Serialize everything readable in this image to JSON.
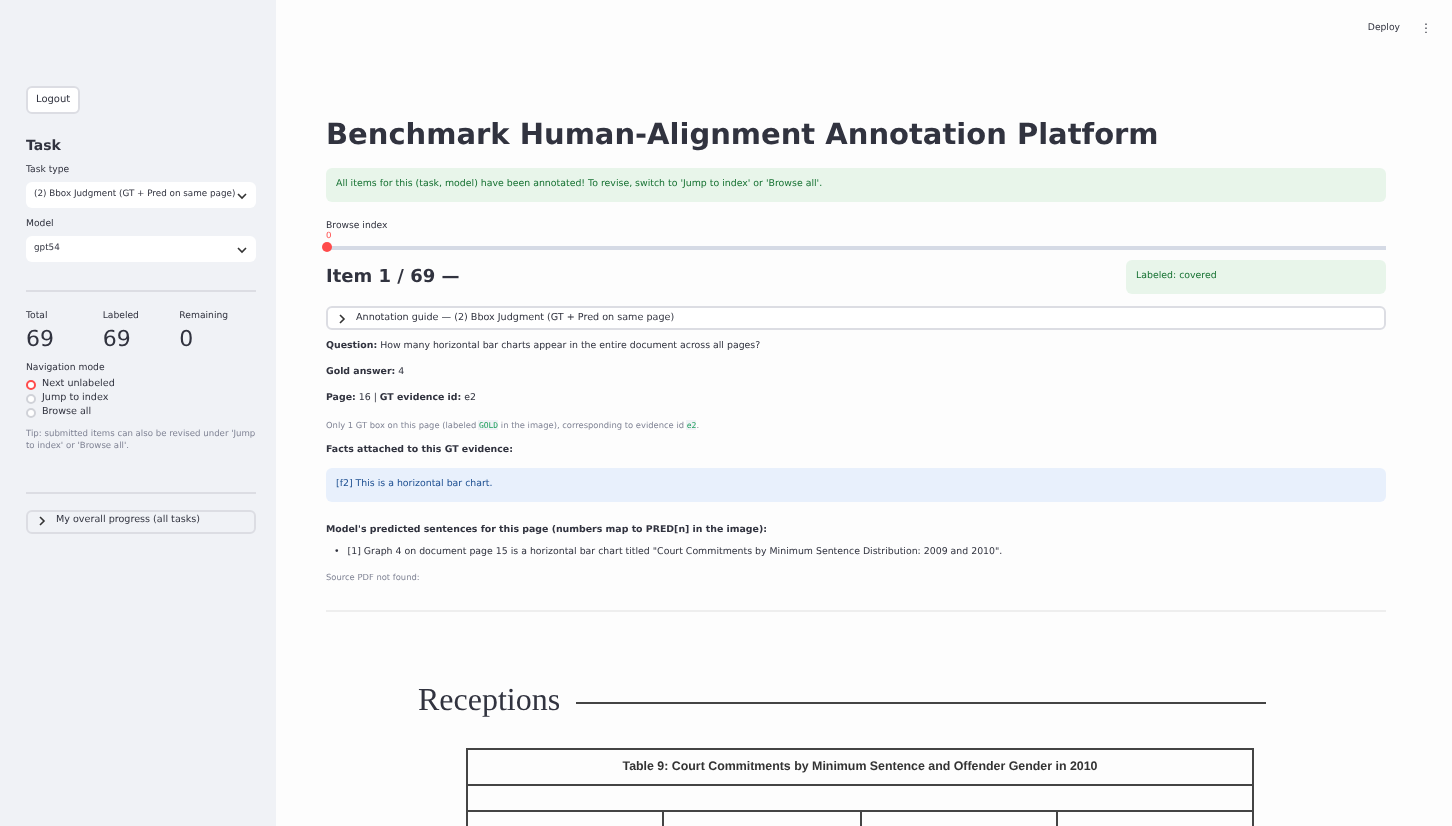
{
  "sidebar": {
    "logout_button": "Logout",
    "section_title": "Task",
    "task_type": {
      "label": "Task type",
      "value": "(2) Bbox Judgment (GT + Pred on same page)"
    },
    "model": {
      "label": "Model",
      "value": "gpt54"
    },
    "metrics": [
      {
        "label": "Total",
        "value": "69"
      },
      {
        "label": "Labeled",
        "value": "69"
      },
      {
        "label": "Remaining",
        "value": "0"
      }
    ],
    "navigation_mode": {
      "label": "Navigation mode",
      "options": [
        {
          "label": "Next unlabeled",
          "selected": true
        },
        {
          "label": "Jump to index",
          "selected": false
        },
        {
          "label": "Browse all",
          "selected": false
        }
      ]
    },
    "tip": "Tip: submitted items can also be revised under 'Jump to index' or 'Browse all'.",
    "progress_expander": {
      "label": "My overall progress (all tasks)",
      "expanded": false
    }
  },
  "toolbar": {
    "deploy": "Deploy",
    "menu": "⋮"
  },
  "main": {
    "title": "Benchmark Human-Alignment Annotation Platform",
    "success_alert": "All items for this (task, model) have been annotated! To revise, switch to 'Jump to index' or 'Browse all'.",
    "browse_index": {
      "label": "Browse index",
      "value": "0",
      "level": 0
    },
    "item_header": "Item 1 / 69 —",
    "status_badge": "Labeled: covered",
    "guide_expander": {
      "label": "Annotation guide — (2) Bbox Judgment (GT + Pred on same page)",
      "expanded": false
    },
    "question": "**Question:** How many horizontal bar charts appear in the entire document across all pages?",
    "gold_answer": "**Gold answer:** 4",
    "page_line": "**Page:** 16 | **GT evidence id:** e2",
    "caption": {
      "before": "Only 1 GT box on this page (labeled",
      "code1": "GOLD",
      "middle": "in the image), corresponding to evidence id",
      "code2": "e2",
      "after": "."
    },
    "facts_heading": "Facts attached to this GT evidence:",
    "fact": "[f2] This is a horizontal bar chart.",
    "predicted_heading": "Model's predicted sentences for this page (numbers map to PRED[n] in the image):",
    "predictions": [
      {
        "marker": "•",
        "text": "[1] Graph 4 on document page 15 is a horizontal bar chart titled \"Court Commitments by Minimum Sentence Distribution: 2009 and 2010\"."
      }
    ],
    "source_note": "Source PDF not found:",
    "document": {
      "heading": "Receptions",
      "table_title": "Table 9:  Court Commitments by Minimum Sentence and Offender Gender in 2010"
    }
  }
}
